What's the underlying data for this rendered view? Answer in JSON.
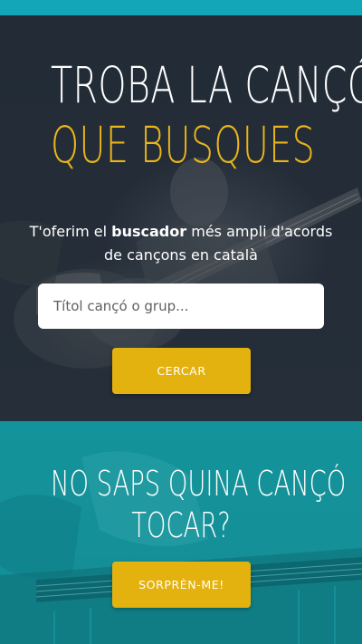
{
  "hero": {
    "title_line1": "TROBA LA CANÇÓ",
    "title_line2": "QUE BUSQUES",
    "subtitle_pre": "T'oferim el ",
    "subtitle_bold": "buscador",
    "subtitle_post": " més ampli d'acords de cançons en català",
    "search": {
      "placeholder": "Títol cançó o grup...",
      "value": "",
      "button_label": "CERCAR"
    }
  },
  "surprise": {
    "title_line1": "NO SAPS QUINA CANÇÓ",
    "title_line2": "TOCAR?",
    "button_label": "SORPRÈN-ME!"
  },
  "colors": {
    "top_bar": "#13a6b8",
    "hero_bg": "#222b36",
    "accent_yellow": "#e4b20f",
    "title_yellow": "#e9b519",
    "teal_bg": "#13939b"
  }
}
